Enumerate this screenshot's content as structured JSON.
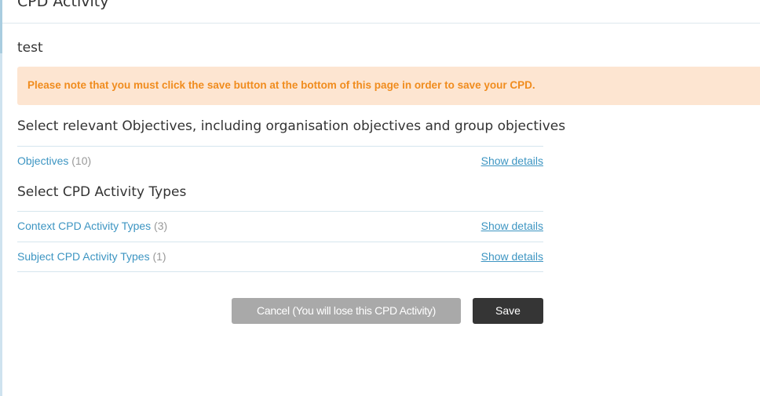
{
  "page": {
    "title": "CPD Activity",
    "record_title": "test"
  },
  "notice": {
    "text": "Please note that you must click the save button at the bottom of this page in order to save your CPD."
  },
  "objectives_section": {
    "heading": "Select relevant Objectives, including organisation objectives and group objectives",
    "rows": [
      {
        "label": "Objectives",
        "count": "(10)",
        "action": "Show details"
      }
    ]
  },
  "activity_types_section": {
    "heading": "Select CPD Activity Types",
    "rows": [
      {
        "label": "Context CPD Activity Types",
        "count": "(3)",
        "action": "Show details"
      },
      {
        "label": "Subject CPD Activity Types",
        "count": "(1)",
        "action": "Show details"
      }
    ]
  },
  "buttons": {
    "cancel_label": "Cancel (You will lose this CPD Activity)",
    "save_label": "Save"
  },
  "colors": {
    "link": "#3d95c2",
    "notice_background": "#fde5d1",
    "notice_text": "#f08c1e",
    "save_button": "#353535",
    "cancel_button": "#a9a9a9"
  }
}
